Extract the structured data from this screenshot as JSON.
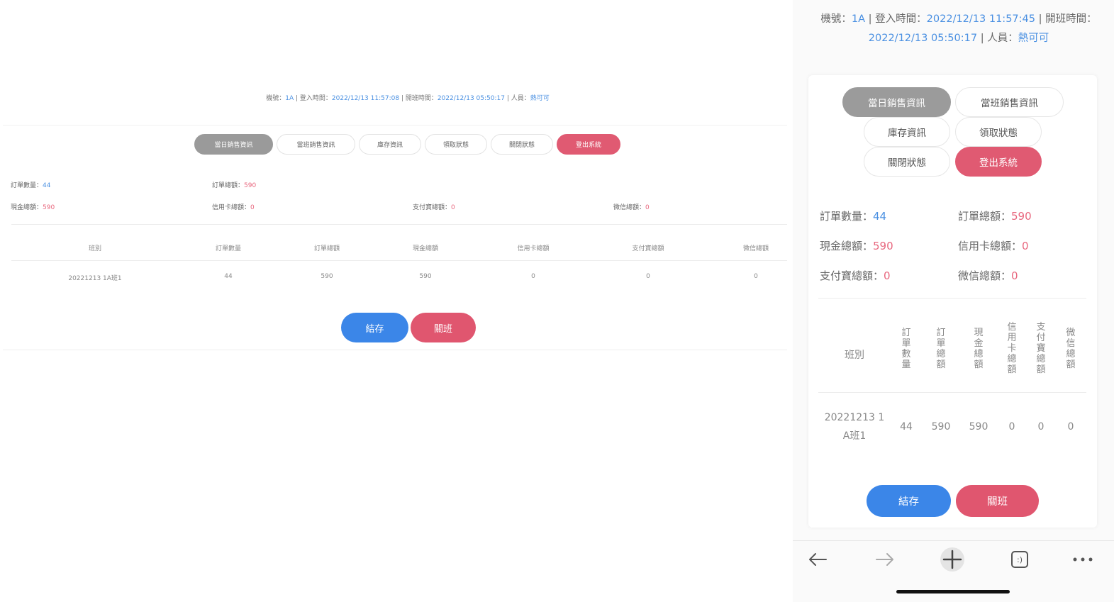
{
  "desktop": {
    "info": {
      "machine_label": "機號：",
      "machine": "1A",
      "login_label": " | 登入時間：",
      "login_time": "2022/12/13 11:57:08",
      "open_label": " | 開班時間：",
      "open_time": "2022/12/13 05:50:17",
      "staff_label": " | 人員：",
      "staff": "熱可可"
    },
    "tabs": [
      "當日銷售資訊",
      "當班銷售資訊",
      "庫存資訊",
      "領取狀態",
      "關閉狀態",
      "登出系統"
    ],
    "stats": {
      "order_count_label": "訂單數量：",
      "order_count": "44",
      "order_total_label": "訂單總額：",
      "order_total": "590",
      "cash_total_label": "現金總額：",
      "cash_total": "590",
      "credit_total_label": "信用卡總額：",
      "credit_total": "0",
      "pay_total_label": "支付寶總額：",
      "pay_total": "0",
      "wechat_total_label": "微信總額：",
      "wechat_total": "0"
    },
    "table": {
      "headers": [
        "班別",
        "訂單數量",
        "訂單總額",
        "現金總額",
        "信用卡總額",
        "支付寶總額",
        "微信總額"
      ],
      "row": [
        "20221213 1A班1",
        "44",
        "590",
        "590",
        "0",
        "0",
        "0"
      ]
    },
    "buttons": {
      "checkout": "結存",
      "close": "關班"
    }
  },
  "mobile": {
    "info": {
      "machine_label": "機號：",
      "machine": "1A",
      "login_label": " | 登入時間：",
      "login_time": "2022/12/13 11:57:45",
      "open_label": " | 開班時間：",
      "open_time": "2022/12/13 05:50:17",
      "staff_label": " | 人員：",
      "staff": "熱可可"
    },
    "tabs": [
      "當日銷售資訊",
      "當班銷售資訊",
      "庫存資訊",
      "領取狀態",
      "關閉狀態",
      "登出系統"
    ],
    "stats": {
      "order_count_label": "訂單數量：",
      "order_count": "44",
      "order_total_label": "訂單總額：",
      "order_total": "590",
      "cash_total_label": "現金總額：",
      "cash_total": "590",
      "credit_total_label": "信用卡總額：",
      "credit_total": "0",
      "pay_total_label": "支付寶總額：",
      "pay_total": "0",
      "wechat_total_label": "微信總額：",
      "wechat_total": "0"
    },
    "table": {
      "headers": [
        "班別",
        "訂單數量",
        "訂單總額",
        "現金總額",
        "信用卡總額",
        "支付寶總額",
        "微信總額"
      ],
      "row": [
        "20221213 1A班1",
        "44",
        "590",
        "590",
        "0",
        "0",
        "0"
      ]
    },
    "buttons": {
      "checkout": "結存",
      "close": "關班"
    },
    "toolbar": {
      "icons": [
        "back-arrow-icon",
        "forward-arrow-icon",
        "new-tab-plus-icon",
        "tab-switcher-icon",
        "more-menu-icon"
      ],
      "tab_count": ":)"
    }
  }
}
